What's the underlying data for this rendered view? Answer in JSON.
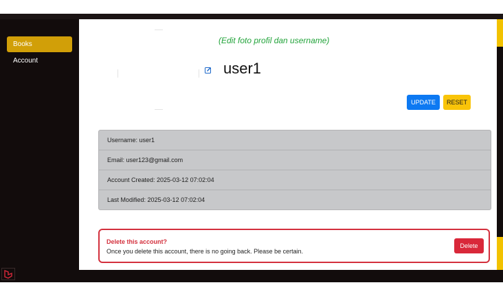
{
  "sidebar": {
    "items": [
      {
        "label": "Books",
        "active": true
      },
      {
        "label": "Account",
        "active": false
      }
    ],
    "logo_icon": "laravel-icon"
  },
  "profile": {
    "hint": "(Edit foto profil dan username)",
    "username": "user1",
    "edit_icon": "pencil-square-icon",
    "update_label": "UPDATE",
    "reset_label": "RESET"
  },
  "info": {
    "rows": [
      "Username: user1",
      "Email: user123@gmail.com",
      "Account Created: 2025-03-12 07:02:04",
      "Last Modified: 2025-03-12 07:02:04"
    ]
  },
  "danger": {
    "title": "Delete this account?",
    "description": "Once you delete this account, there is no going back. Please be certain.",
    "delete_label": "Delete"
  },
  "colors": {
    "sidebar_bg": "#120c0c",
    "active_nav": "#d19f08",
    "hint_green": "#22a33a",
    "update_blue": "#0d79f2",
    "reset_yellow": "#f9c409",
    "danger_red": "#d32f3c"
  }
}
